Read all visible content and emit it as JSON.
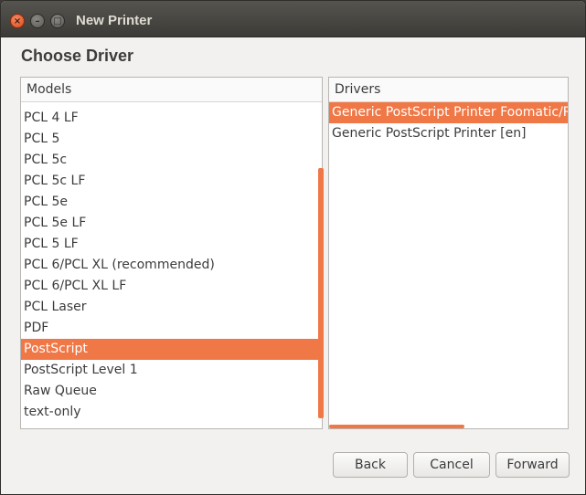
{
  "window": {
    "title": "New Printer",
    "controls": {
      "close": "×",
      "minimize": "–",
      "maximize": "□"
    }
  },
  "heading": "Choose Driver",
  "models": {
    "header": "Models",
    "items": [
      "PCL 4 LF",
      "PCL 5",
      "PCL 5c",
      "PCL 5c LF",
      "PCL 5e",
      "PCL 5e LF",
      "PCL 5 LF",
      "PCL 6/PCL XL (recommended)",
      "PCL 6/PCL XL LF",
      "PCL Laser",
      "PDF",
      "PostScript",
      "PostScript Level 1",
      "Raw Queue",
      "text-only"
    ],
    "selected": "PostScript"
  },
  "drivers": {
    "header": "Drivers",
    "items": [
      "Generic PostScript Printer Foomatic/Po",
      "Generic PostScript Printer [en]"
    ],
    "selected": "Generic PostScript Printer Foomatic/Po"
  },
  "buttons": {
    "back": "Back",
    "cancel": "Cancel",
    "forward": "Forward"
  },
  "colors": {
    "accent": "#f07746",
    "titlebar": "#3c3b37",
    "background": "#f2f1f0"
  }
}
